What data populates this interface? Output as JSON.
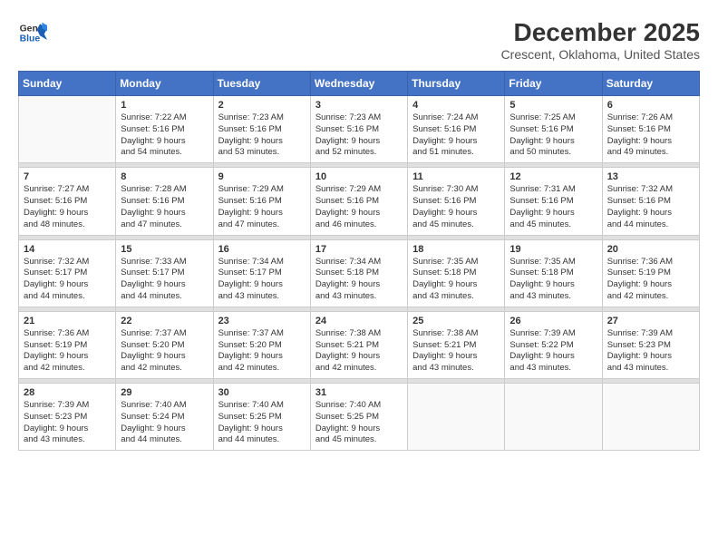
{
  "app": {
    "name_line1": "General",
    "name_line2": "Blue"
  },
  "title": "December 2025",
  "subtitle": "Crescent, Oklahoma, United States",
  "days_header": [
    "Sunday",
    "Monday",
    "Tuesday",
    "Wednesday",
    "Thursday",
    "Friday",
    "Saturday"
  ],
  "weeks": [
    {
      "days": [
        {
          "num": "",
          "info": ""
        },
        {
          "num": "1",
          "info": "Sunrise: 7:22 AM\nSunset: 5:16 PM\nDaylight: 9 hours\nand 54 minutes."
        },
        {
          "num": "2",
          "info": "Sunrise: 7:23 AM\nSunset: 5:16 PM\nDaylight: 9 hours\nand 53 minutes."
        },
        {
          "num": "3",
          "info": "Sunrise: 7:23 AM\nSunset: 5:16 PM\nDaylight: 9 hours\nand 52 minutes."
        },
        {
          "num": "4",
          "info": "Sunrise: 7:24 AM\nSunset: 5:16 PM\nDaylight: 9 hours\nand 51 minutes."
        },
        {
          "num": "5",
          "info": "Sunrise: 7:25 AM\nSunset: 5:16 PM\nDaylight: 9 hours\nand 50 minutes."
        },
        {
          "num": "6",
          "info": "Sunrise: 7:26 AM\nSunset: 5:16 PM\nDaylight: 9 hours\nand 49 minutes."
        }
      ]
    },
    {
      "days": [
        {
          "num": "7",
          "info": "Sunrise: 7:27 AM\nSunset: 5:16 PM\nDaylight: 9 hours\nand 48 minutes."
        },
        {
          "num": "8",
          "info": "Sunrise: 7:28 AM\nSunset: 5:16 PM\nDaylight: 9 hours\nand 47 minutes."
        },
        {
          "num": "9",
          "info": "Sunrise: 7:29 AM\nSunset: 5:16 PM\nDaylight: 9 hours\nand 47 minutes."
        },
        {
          "num": "10",
          "info": "Sunrise: 7:29 AM\nSunset: 5:16 PM\nDaylight: 9 hours\nand 46 minutes."
        },
        {
          "num": "11",
          "info": "Sunrise: 7:30 AM\nSunset: 5:16 PM\nDaylight: 9 hours\nand 45 minutes."
        },
        {
          "num": "12",
          "info": "Sunrise: 7:31 AM\nSunset: 5:16 PM\nDaylight: 9 hours\nand 45 minutes."
        },
        {
          "num": "13",
          "info": "Sunrise: 7:32 AM\nSunset: 5:16 PM\nDaylight: 9 hours\nand 44 minutes."
        }
      ]
    },
    {
      "days": [
        {
          "num": "14",
          "info": "Sunrise: 7:32 AM\nSunset: 5:17 PM\nDaylight: 9 hours\nand 44 minutes."
        },
        {
          "num": "15",
          "info": "Sunrise: 7:33 AM\nSunset: 5:17 PM\nDaylight: 9 hours\nand 44 minutes."
        },
        {
          "num": "16",
          "info": "Sunrise: 7:34 AM\nSunset: 5:17 PM\nDaylight: 9 hours\nand 43 minutes."
        },
        {
          "num": "17",
          "info": "Sunrise: 7:34 AM\nSunset: 5:18 PM\nDaylight: 9 hours\nand 43 minutes."
        },
        {
          "num": "18",
          "info": "Sunrise: 7:35 AM\nSunset: 5:18 PM\nDaylight: 9 hours\nand 43 minutes."
        },
        {
          "num": "19",
          "info": "Sunrise: 7:35 AM\nSunset: 5:18 PM\nDaylight: 9 hours\nand 43 minutes."
        },
        {
          "num": "20",
          "info": "Sunrise: 7:36 AM\nSunset: 5:19 PM\nDaylight: 9 hours\nand 42 minutes."
        }
      ]
    },
    {
      "days": [
        {
          "num": "21",
          "info": "Sunrise: 7:36 AM\nSunset: 5:19 PM\nDaylight: 9 hours\nand 42 minutes."
        },
        {
          "num": "22",
          "info": "Sunrise: 7:37 AM\nSunset: 5:20 PM\nDaylight: 9 hours\nand 42 minutes."
        },
        {
          "num": "23",
          "info": "Sunrise: 7:37 AM\nSunset: 5:20 PM\nDaylight: 9 hours\nand 42 minutes."
        },
        {
          "num": "24",
          "info": "Sunrise: 7:38 AM\nSunset: 5:21 PM\nDaylight: 9 hours\nand 42 minutes."
        },
        {
          "num": "25",
          "info": "Sunrise: 7:38 AM\nSunset: 5:21 PM\nDaylight: 9 hours\nand 43 minutes."
        },
        {
          "num": "26",
          "info": "Sunrise: 7:39 AM\nSunset: 5:22 PM\nDaylight: 9 hours\nand 43 minutes."
        },
        {
          "num": "27",
          "info": "Sunrise: 7:39 AM\nSunset: 5:23 PM\nDaylight: 9 hours\nand 43 minutes."
        }
      ]
    },
    {
      "days": [
        {
          "num": "28",
          "info": "Sunrise: 7:39 AM\nSunset: 5:23 PM\nDaylight: 9 hours\nand 43 minutes."
        },
        {
          "num": "29",
          "info": "Sunrise: 7:40 AM\nSunset: 5:24 PM\nDaylight: 9 hours\nand 44 minutes."
        },
        {
          "num": "30",
          "info": "Sunrise: 7:40 AM\nSunset: 5:25 PM\nDaylight: 9 hours\nand 44 minutes."
        },
        {
          "num": "31",
          "info": "Sunrise: 7:40 AM\nSunset: 5:25 PM\nDaylight: 9 hours\nand 45 minutes."
        },
        {
          "num": "",
          "info": ""
        },
        {
          "num": "",
          "info": ""
        },
        {
          "num": "",
          "info": ""
        }
      ]
    }
  ]
}
